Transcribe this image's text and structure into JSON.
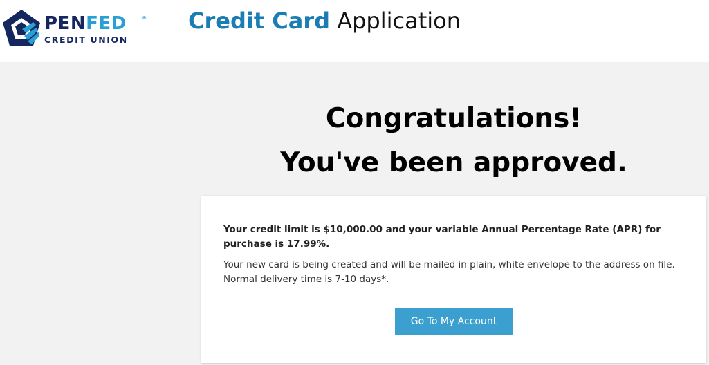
{
  "header": {
    "logo": {
      "name_part1": "PEN",
      "name_part2": "FED",
      "registered": "®",
      "subtitle": "CREDIT UNION",
      "icon": "penfed-pentagon-logo"
    },
    "title_strong": "Credit Card",
    "title_rest": " Application"
  },
  "main": {
    "heading_line1": "Congratulations!",
    "heading_line2": "You've been approved.",
    "card": {
      "limit_text": "Your credit limit is $10,000.00 and your variable Annual Percentage Rate (APR) for purchase is 17.99%.",
      "mail_text": "Your new card is being created and will be mailed in plain, white envelope to the address on file. Normal delivery time is 7-10 days*.",
      "button_label": "Go To My Account"
    }
  },
  "colors": {
    "brand_navy": "#14275e",
    "brand_blue": "#2a9fd6",
    "title_blue": "#1a7db3",
    "button_blue": "#3ba0cf",
    "page_background": "#f2f2f2"
  }
}
